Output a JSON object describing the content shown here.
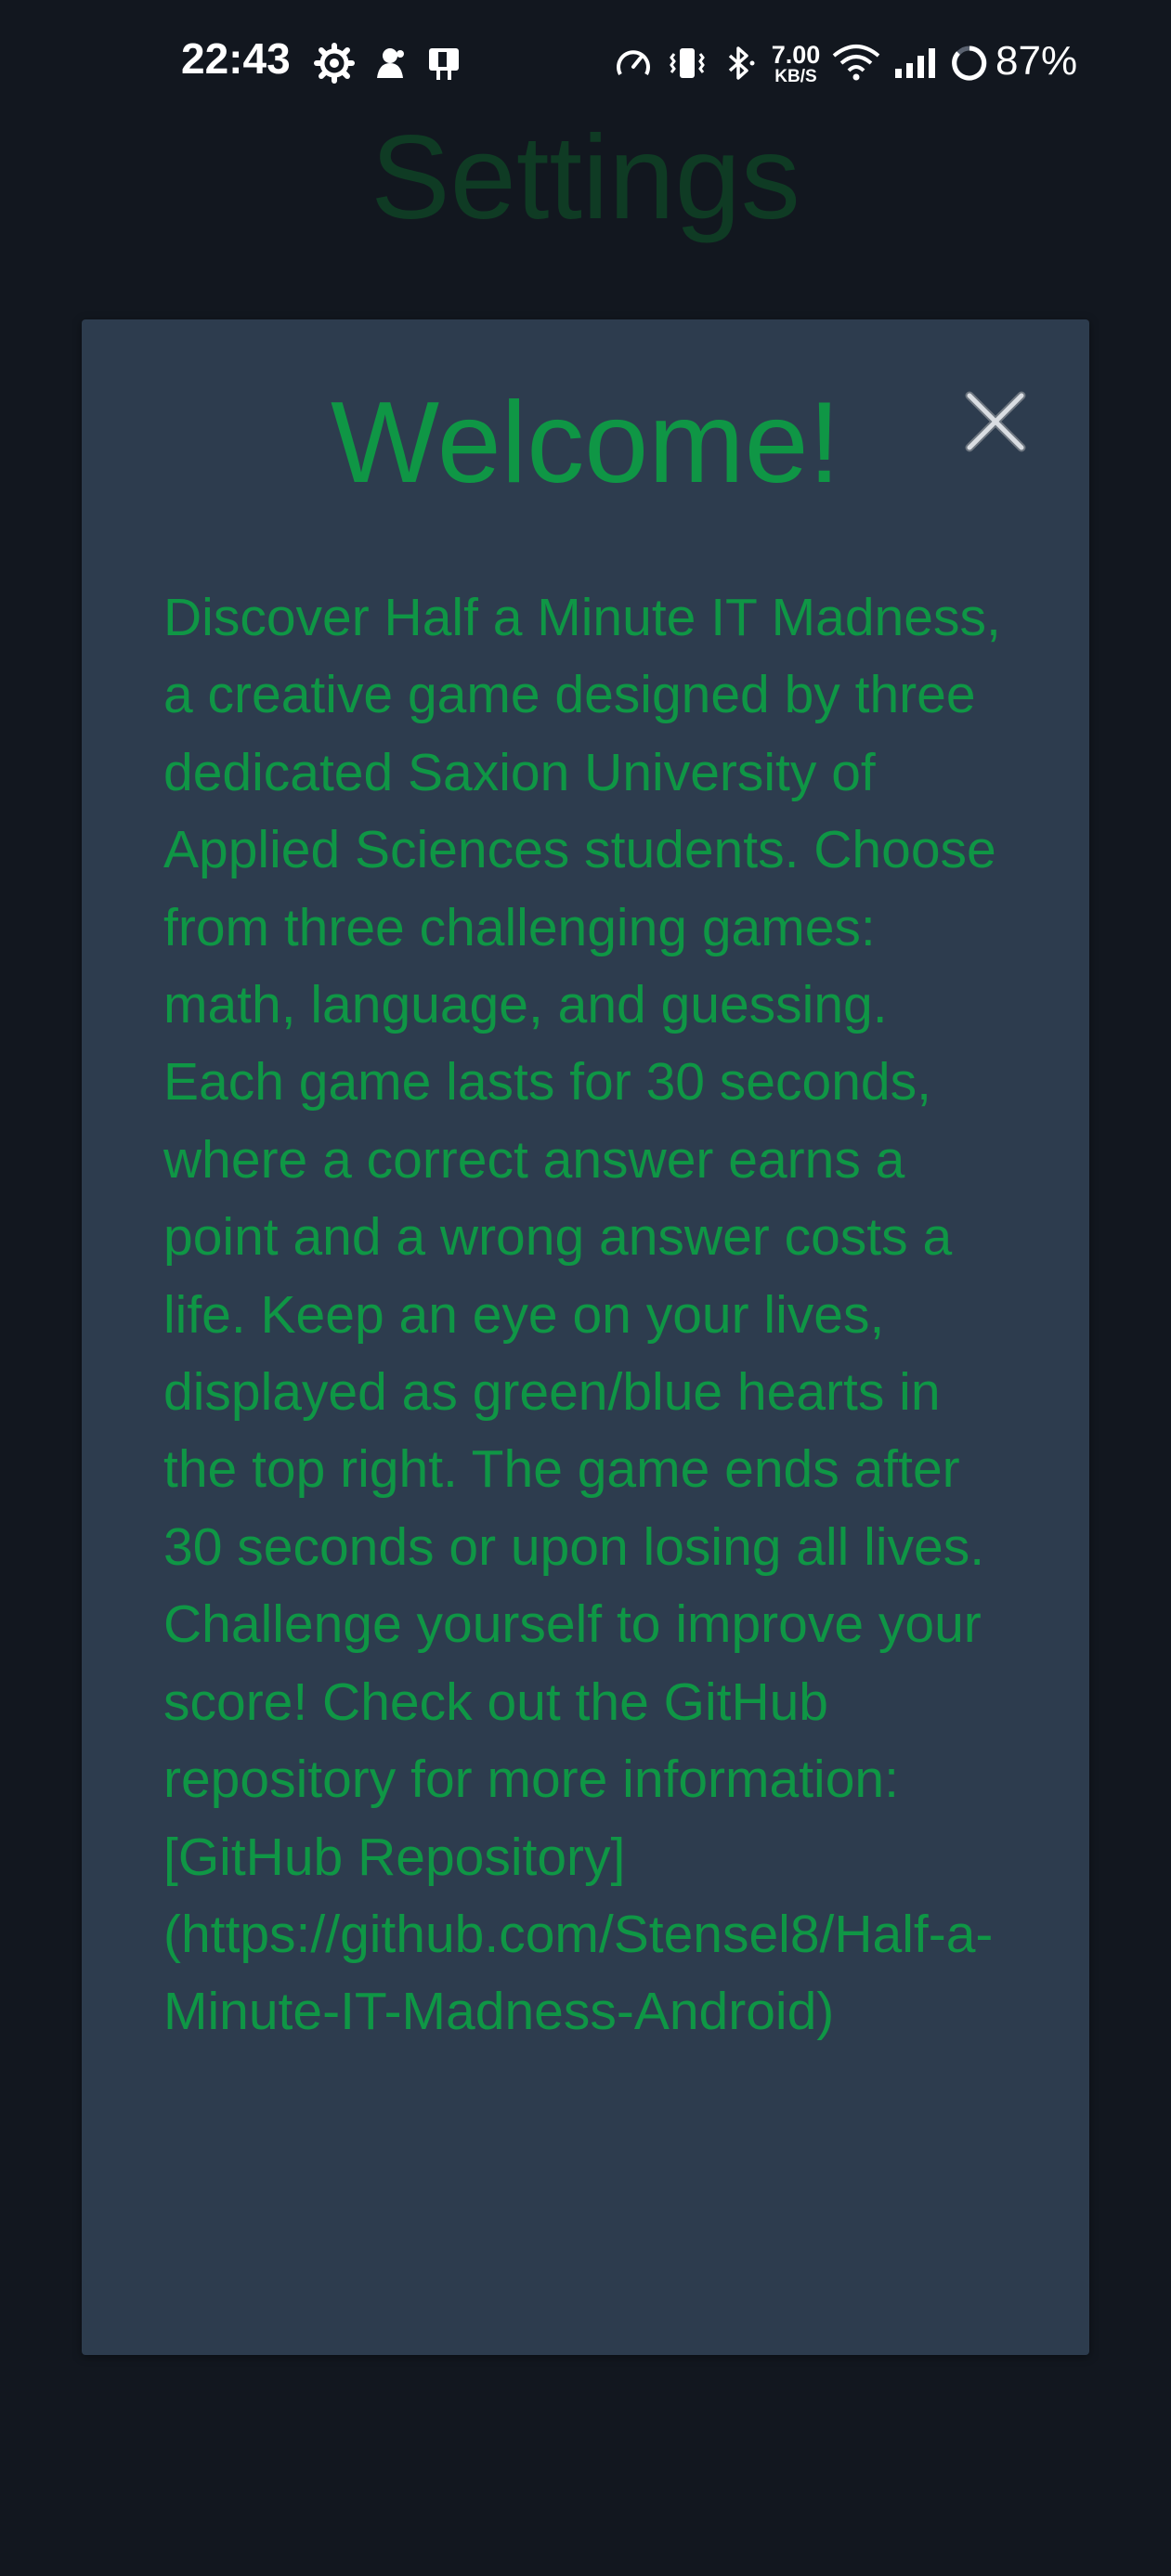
{
  "status_bar": {
    "time": "22:43",
    "network_speed_value": "7.00",
    "network_speed_unit": "KB/S",
    "battery_percent": "87%",
    "icons": [
      "settings-gear-icon",
      "notification-icon",
      "sim-app-icon",
      "data-saver-icon",
      "vibrate-icon",
      "bluetooth-icon",
      "wifi-icon",
      "signal-icon",
      "battery-ring-icon"
    ]
  },
  "background": {
    "title": "Settings"
  },
  "modal": {
    "title": "Welcome!",
    "close_icon": "close-icon",
    "body": "Discover Half a Minute IT Madness, a creative game designed by three dedicated Saxion University of Applied Sciences students. Choose from three challenging games: math, language, and guessing. Each game lasts for 30 seconds, where a correct answer earns a point and a wrong answer costs a life. Keep an eye on your lives, displayed as green/blue hearts in the top right. The game ends after 30 seconds or upon losing all lives. Challenge yourself to improve your score! Check out the GitHub repository for more information: [GitHub Repository](https://github.com/Stensel8/Half-a-Minute-IT-Madness-Android)"
  },
  "colors": {
    "background": "#12171f",
    "modal_background": "#2d3c4e",
    "accent_green": "#0f9645",
    "dim_title_green": "#0f3b24",
    "status_text": "#ffffff"
  }
}
